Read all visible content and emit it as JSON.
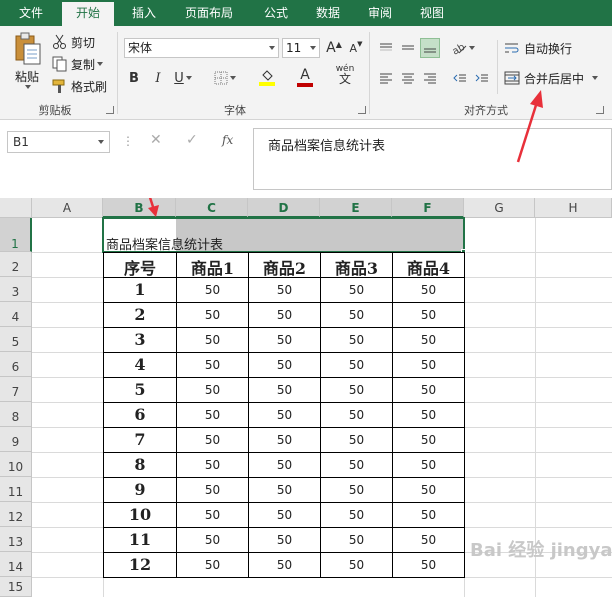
{
  "tabs": [
    "文件",
    "开始",
    "插入",
    "页面布局",
    "公式",
    "数据",
    "审阅",
    "视图"
  ],
  "clipboard": {
    "paste": "粘贴",
    "cut": "剪切",
    "copy": "复制",
    "format_painter": "格式刷",
    "group_label": "剪贴板"
  },
  "font": {
    "name": "宋体",
    "size": "11",
    "grow": "A",
    "shrink": "A",
    "bold": "B",
    "italic": "I",
    "underline": "U",
    "phonetic": "wén",
    "group_label": "字体"
  },
  "alignment": {
    "wrap_text": "自动换行",
    "merge_center": "合并后居中",
    "group_label": "对齐方式"
  },
  "formula_bar": {
    "name_box": "B1",
    "fx": "fx",
    "content": "商品档案信息统计表"
  },
  "columns": [
    "A",
    "B",
    "C",
    "D",
    "E",
    "F",
    "G",
    "H"
  ],
  "rows": [
    "1",
    "2",
    "3",
    "4",
    "5",
    "6",
    "7",
    "8",
    "9",
    "10",
    "11",
    "12",
    "13",
    "14",
    "15"
  ],
  "sheet": {
    "title": "商品档案信息统计表",
    "headers": [
      "序号",
      "商品1",
      "商品2",
      "商品3",
      "商品4"
    ],
    "data": [
      [
        "1",
        "50",
        "50",
        "50",
        "50"
      ],
      [
        "2",
        "50",
        "50",
        "50",
        "50"
      ],
      [
        "3",
        "50",
        "50",
        "50",
        "50"
      ],
      [
        "4",
        "50",
        "50",
        "50",
        "50"
      ],
      [
        "5",
        "50",
        "50",
        "50",
        "50"
      ],
      [
        "6",
        "50",
        "50",
        "50",
        "50"
      ],
      [
        "7",
        "50",
        "50",
        "50",
        "50"
      ],
      [
        "8",
        "50",
        "50",
        "50",
        "50"
      ],
      [
        "9",
        "50",
        "50",
        "50",
        "50"
      ],
      [
        "10",
        "50",
        "50",
        "50",
        "50"
      ],
      [
        "11",
        "50",
        "50",
        "50",
        "50"
      ],
      [
        "12",
        "50",
        "50",
        "50",
        "50"
      ]
    ]
  },
  "watermark": "Bai 经验 jingyan.baidu.com",
  "colors": {
    "excel_green": "#217346",
    "selection_fill": "#c8c8c8",
    "arrow_red": "#e8303a",
    "font_color_bar": "#c00000",
    "fill_color_bar": "#ffff00"
  }
}
